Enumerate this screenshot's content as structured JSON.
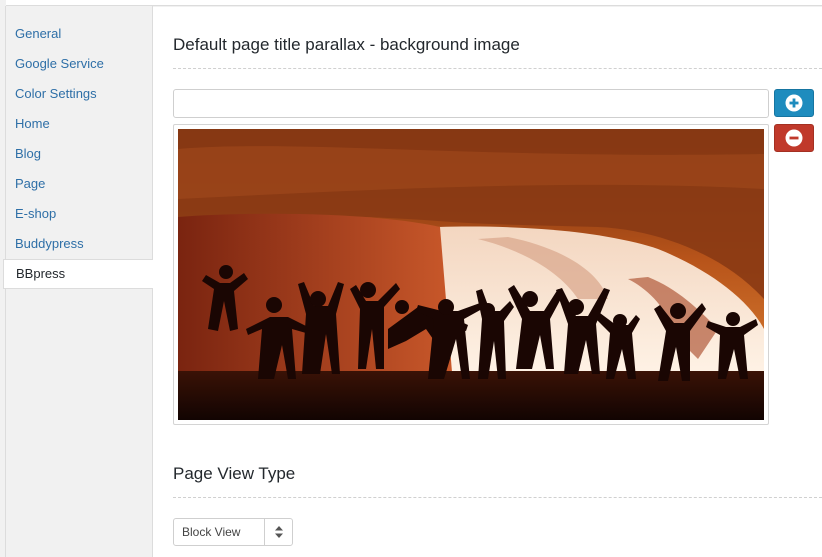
{
  "sidebar": {
    "items": [
      {
        "label": "General"
      },
      {
        "label": "Google Service"
      },
      {
        "label": "Color Settings"
      },
      {
        "label": "Home"
      },
      {
        "label": "Blog"
      },
      {
        "label": "Page"
      },
      {
        "label": "E-shop"
      },
      {
        "label": "Buddypress"
      },
      {
        "label": "BBpress",
        "active": true
      }
    ]
  },
  "main": {
    "bg_section": {
      "title": "Default page title parallax - background image",
      "url_value": "",
      "add_icon": "plus-circle-icon",
      "remove_icon": "minus-circle-icon",
      "image_subject": "silhouettes of people jumping under a red rock arch"
    },
    "view_section": {
      "title": "Page View Type",
      "select_value": "Block View",
      "select_icon": "sort-arrows-icon"
    }
  },
  "colors": {
    "link": "#2e6fa7",
    "add_button": "#1e8cbe",
    "remove_button": "#c0392b"
  }
}
